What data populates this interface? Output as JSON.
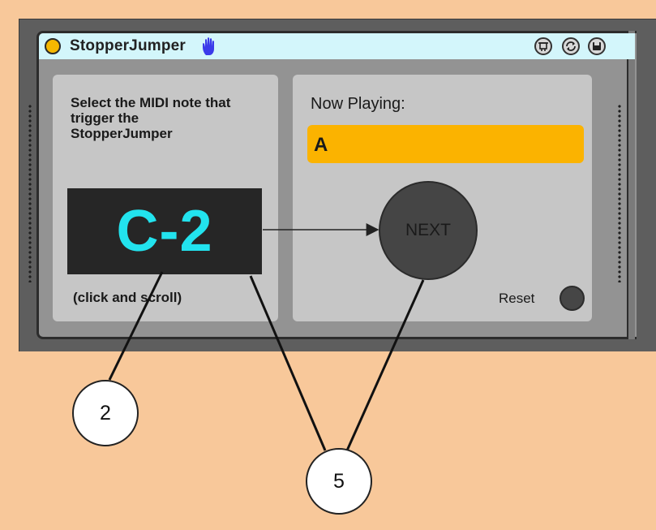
{
  "device": {
    "title": "StopperJumper",
    "title_icon": "hand-icon",
    "buttons": [
      "map-icon",
      "refresh-icon",
      "save-icon"
    ]
  },
  "left_panel": {
    "instruction": "Select the MIDI note that trigger the StopperJumper",
    "note_value": "C-2",
    "hint": "(click and scroll)"
  },
  "right_panel": {
    "now_playing_label": "Now Playing:",
    "now_playing_value": "A",
    "next_label": "NEXT",
    "reset_label": "Reset"
  },
  "callouts": {
    "first": "2",
    "second": "5"
  },
  "colors": {
    "background": "#f8c89a",
    "title_bar": "#d3f6fb",
    "note_text": "#22e3ee",
    "now_playing_field": "#fbb300"
  }
}
